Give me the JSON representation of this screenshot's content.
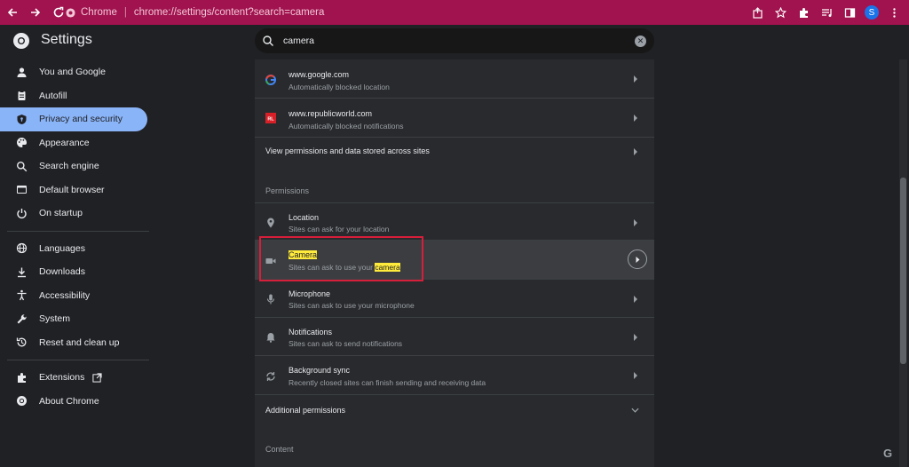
{
  "browser": {
    "site_label": "Chrome",
    "url": "chrome://settings/content?search=camera",
    "avatar_letter": "S",
    "accent": "#a0134e"
  },
  "header": {
    "title": "Settings",
    "search_value": "camera"
  },
  "sidebar": {
    "items": [
      {
        "label": "You and Google",
        "icon": "person-icon"
      },
      {
        "label": "Autofill",
        "icon": "clipboard-icon"
      },
      {
        "label": "Privacy and security",
        "icon": "shield-icon",
        "active": true
      },
      {
        "label": "Appearance",
        "icon": "palette-icon"
      },
      {
        "label": "Search engine",
        "icon": "search-icon"
      },
      {
        "label": "Default browser",
        "icon": "browser-icon"
      },
      {
        "label": "On startup",
        "icon": "power-icon"
      },
      {
        "label": "Languages",
        "icon": "globe-icon"
      },
      {
        "label": "Downloads",
        "icon": "download-icon"
      },
      {
        "label": "Accessibility",
        "icon": "accessibility-icon"
      },
      {
        "label": "System",
        "icon": "wrench-icon"
      },
      {
        "label": "Reset and clean up",
        "icon": "reset-icon"
      },
      {
        "label": "Extensions",
        "icon": "puzzle-icon"
      },
      {
        "label": "About Chrome",
        "icon": "chrome-icon"
      }
    ]
  },
  "main": {
    "sites": [
      {
        "title": "www.google.com",
        "subtitle": "Automatically blocked location"
      },
      {
        "title": "www.republicworld.com",
        "subtitle": "Automatically blocked notifications"
      }
    ],
    "view_permissions": "View permissions and data stored across sites",
    "permissions_heading": "Permissions",
    "permissions": [
      {
        "title": "Location",
        "subtitle": "Sites can ask for your location",
        "icon": "location-icon"
      },
      {
        "title": "Camera",
        "subtitle_prefix": "Sites can ask to use your ",
        "subtitle_hl": "camera",
        "icon": "camera-icon"
      },
      {
        "title": "Microphone",
        "subtitle": "Sites can ask to use your microphone",
        "icon": "microphone-icon"
      },
      {
        "title": "Notifications",
        "subtitle": "Sites can ask to send notifications",
        "icon": "bell-icon"
      },
      {
        "title": "Background sync",
        "subtitle": "Recently closed sites can finish sending and receiving data",
        "icon": "sync-icon"
      }
    ],
    "additional_permissions": "Additional permissions",
    "content_heading": "Content"
  },
  "watermark": "G"
}
